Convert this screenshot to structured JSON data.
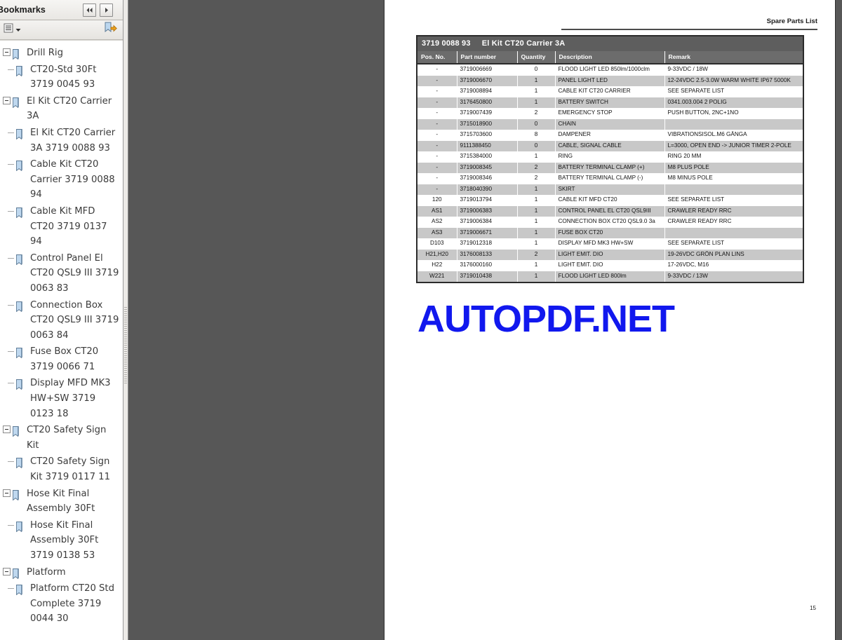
{
  "sidebar": {
    "title": "Bookmarks",
    "nav_prev_icon": "rewind-icon",
    "nav_next_icon": "play-icon",
    "toolbar": {
      "options_menu_label": "options-menu",
      "expand_icon": "list-options-icon",
      "chevron_icon": "chevron-down-icon",
      "new_bookmark_icon": "new-bookmark-icon"
    },
    "bookmarks": [
      {
        "label": "Drill Rig",
        "depth": 0,
        "expanded": true
      },
      {
        "label": "CT20-Std 30Ft 3719 0045 93",
        "depth": 1,
        "expanded": false
      },
      {
        "label": "El Kit CT20 Carrier 3A",
        "depth": 0,
        "expanded": true
      },
      {
        "label": "El Kit CT20 Carrier 3A 3719 0088 93",
        "depth": 1,
        "expanded": false
      },
      {
        "label": "Cable Kit CT20 Carrier 3719 0088 94",
        "depth": 1,
        "expanded": false
      },
      {
        "label": "Cable Kit MFD CT20 3719 0137 94",
        "depth": 1,
        "expanded": false
      },
      {
        "label": "Control Panel El CT20 QSL9 III 3719 0063 83",
        "depth": 1,
        "expanded": false
      },
      {
        "label": "Connection Box CT20 QSL9 III 3719 0063 84",
        "depth": 1,
        "expanded": false
      },
      {
        "label": "Fuse Box CT20 3719 0066 71",
        "depth": 1,
        "expanded": false
      },
      {
        "label": "Display MFD MK3 HW+SW 3719 0123 18",
        "depth": 1,
        "expanded": false
      },
      {
        "label": "CT20 Safety Sign Kit",
        "depth": 0,
        "expanded": true
      },
      {
        "label": "CT20 Safety Sign Kit 3719 0117 11",
        "depth": 1,
        "expanded": false
      },
      {
        "label": "Hose Kit Final Assembly 30Ft",
        "depth": 0,
        "expanded": true
      },
      {
        "label": "Hose Kit Final Assembly 30Ft 3719 0138 53",
        "depth": 1,
        "expanded": false
      },
      {
        "label": "Platform",
        "depth": 0,
        "expanded": true
      },
      {
        "label": "Platform CT20 Std Complete 3719 0044 30",
        "depth": 1,
        "expanded": false
      }
    ]
  },
  "document": {
    "header_right": "Spare Parts List",
    "page_number": "15",
    "watermark": "AUTOPDF.NET",
    "watermark_color": "#1118ee",
    "table": {
      "title_number": "3719 0088 93",
      "title_description": "El Kit CT20 Carrier 3A",
      "columns": [
        "Pos. No.",
        "Part number",
        "Quantity",
        "Description",
        "Remark"
      ],
      "rows": [
        {
          "pos": "-",
          "part": "3719006669",
          "qty": "0",
          "desc": "FLOOD LIGHT LED 850lm/1000clm",
          "remark": "9-33VDC / 18W",
          "shade": false
        },
        {
          "pos": "-",
          "part": "3719006670",
          "qty": "1",
          "desc": "PANEL LIGHT LED",
          "remark": "12-24VDC 2.5-3.0W WARM WHITE IP67 5000K",
          "shade": true
        },
        {
          "pos": "-",
          "part": "3719008894",
          "qty": "1",
          "desc": "CABLE KIT CT20 CARRIER",
          "remark": "SEE SEPARATE LIST",
          "shade": false
        },
        {
          "pos": "-",
          "part": "3176450800",
          "qty": "1",
          "desc": "BATTERY SWITCH",
          "remark": "0341.003.004 2 POLIG",
          "shade": true
        },
        {
          "pos": "-",
          "part": "3719007439",
          "qty": "2",
          "desc": "EMERGENCY STOP",
          "remark": "PUSH BUTTON, 2NC+1NO",
          "shade": false
        },
        {
          "pos": "-",
          "part": "3715018900",
          "qty": "0",
          "desc": "CHAIN",
          "remark": "",
          "shade": true
        },
        {
          "pos": "-",
          "part": "3715703600",
          "qty": "8",
          "desc": "DAMPENER",
          "remark": "VIBRATIONSISOL.M6 GÄNGA",
          "shade": false
        },
        {
          "pos": "-",
          "part": "9111388450",
          "qty": "0",
          "desc": "CABLE, SIGNAL CABLE",
          "remark": "L=3000, OPEN END -> JUNIOR TIMER 2-POLE",
          "shade": true
        },
        {
          "pos": "-",
          "part": "3715384000",
          "qty": "1",
          "desc": "RING",
          "remark": "RING 20 MM",
          "shade": false
        },
        {
          "pos": "-",
          "part": "3719008345",
          "qty": "2",
          "desc": "BATTERY TERMINAL CLAMP (+)",
          "remark": "M8 PLUS POLE",
          "shade": true
        },
        {
          "pos": "-",
          "part": "3719008346",
          "qty": "2",
          "desc": "BATTERY TERMINAL CLAMP (-)",
          "remark": "M8 MINUS POLE",
          "shade": false
        },
        {
          "pos": "-",
          "part": "3718040390",
          "qty": "1",
          "desc": "SKIRT",
          "remark": "",
          "shade": true
        },
        {
          "pos": "120",
          "part": "3719013794",
          "qty": "1",
          "desc": "CABLE KIT MFD CT20",
          "remark": "SEE SEPARATE LIST",
          "shade": false
        },
        {
          "pos": "AS1",
          "part": "3719006383",
          "qty": "1",
          "desc": "CONTROL PANEL EL CT20 QSL9III",
          "remark": "CRAWLER READY RRC",
          "shade": true
        },
        {
          "pos": "AS2",
          "part": "3719006384",
          "qty": "1",
          "desc": "CONNECTION BOX CT20 QSL9.0 3a",
          "remark": "CRAWLER READY RRC",
          "shade": false
        },
        {
          "pos": "AS3",
          "part": "3719006671",
          "qty": "1",
          "desc": "FUSE BOX CT20",
          "remark": "",
          "shade": true
        },
        {
          "pos": "D103",
          "part": "3719012318",
          "qty": "1",
          "desc": "DISPLAY MFD MK3 HW+SW",
          "remark": "SEE SEPARATE LIST",
          "shade": false
        },
        {
          "pos": "H21,H20",
          "part": "3176008133",
          "qty": "2",
          "desc": "LIGHT EMIT. DIO",
          "remark": "19-26VDC GRÖN PLAN LINS",
          "shade": true
        },
        {
          "pos": "H22",
          "part": "3176000160",
          "qty": "1",
          "desc": "LIGHT EMIT. DIO",
          "remark": "17-26VDC, M16",
          "shade": false
        },
        {
          "pos": "W221",
          "part": "3719010438",
          "qty": "1",
          "desc": "FLOOD LIGHT LED 800lm",
          "remark": "9-33VDC / 13W",
          "shade": true
        }
      ]
    }
  }
}
